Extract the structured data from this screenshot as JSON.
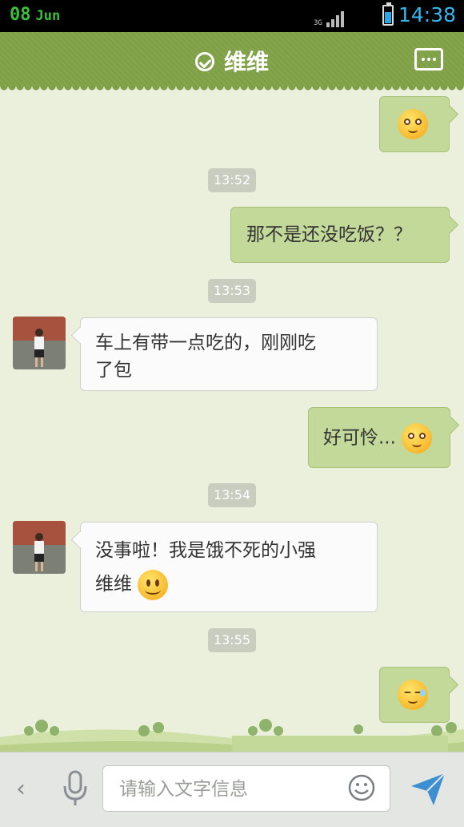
{
  "status_bar": {
    "day": "08",
    "month": "Jun",
    "network": "3G",
    "time": "14:38"
  },
  "header": {
    "title": "维维",
    "verified_icon": "check-circle-icon",
    "menu_icon": "more-icon"
  },
  "messages": [
    {
      "id": "m1",
      "type": "out",
      "emoji": "pitiful"
    },
    {
      "id": "t1",
      "type": "timestamp",
      "text": "13:52"
    },
    {
      "id": "m2",
      "type": "out",
      "text": "那不是还没吃饭？？"
    },
    {
      "id": "t2",
      "type": "timestamp",
      "text": "13:53"
    },
    {
      "id": "m3",
      "type": "in",
      "line1": "车上有带一点吃的，刚刚吃",
      "line2": "了包"
    },
    {
      "id": "m4",
      "type": "out",
      "text": "好可怜...",
      "emoji": "pitiful"
    },
    {
      "id": "t3",
      "type": "timestamp",
      "text": "13:54"
    },
    {
      "id": "m5",
      "type": "in",
      "line1": "没事啦！我是饿不死的小强",
      "line2": "维维",
      "emoji": "smile"
    },
    {
      "id": "t4",
      "type": "timestamp",
      "text": "13:55"
    },
    {
      "id": "m6",
      "type": "out",
      "emoji": "sweat"
    }
  ],
  "input_bar": {
    "placeholder": "请输入文字信息",
    "back_icon": "chevron-left-icon",
    "mic_icon": "microphone-icon",
    "emoji_icon": "smiley-icon",
    "send_icon": "send-icon"
  },
  "colors": {
    "header": "#7fa046",
    "outgoing_bubble": "#c3d99a",
    "incoming_bubble": "#fbfbfb",
    "background": "#eaf0dc",
    "time": "#34b6ee"
  }
}
